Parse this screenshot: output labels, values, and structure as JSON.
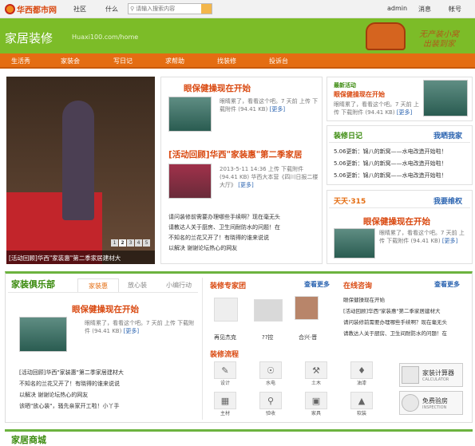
{
  "topbar": {
    "logo": "华西都市网",
    "community": "社区",
    "what": "什么",
    "search_placeholder": "请输入搜索内容",
    "admin": "admin",
    "message": "消息",
    "account": "帐号"
  },
  "header": {
    "title": "家居装修",
    "url": "Huaxi100.com/home",
    "slogan_1": "无产装小窝",
    "slogan_2": "出装到家"
  },
  "nav": [
    "生活秀",
    "家装会",
    "写日记",
    "求帮助",
    "找装修",
    "投诉台"
  ],
  "slideshow": {
    "caption": "[活动回顾]华西\"家装惠\"第二季家居建材大",
    "pages": [
      "1",
      "2",
      "3",
      "4",
      "5"
    ],
    "active": "2"
  },
  "feature1": {
    "title": "眼保健操现在开始",
    "desc": "眼睛累了，看看这个吧。7 天前 上传 下载附件 (94.41 KB)",
    "more": "[更多]"
  },
  "feature2": {
    "title": "[活动回顾]华西\"家装惠\"第二季家居",
    "desc": "2013-5-11 14:36 上传 下载附件 (94.41 KB) 华西大本营《四川日报二楼大厅》",
    "more": "[更多]",
    "list": [
      "请问装修前需要办理哪些手续啊？现在毫无头",
      "请教达人关于厨房、卫生间耐防水的问题！在",
      "不知名的兰花又开了！有晓得的谁来说说",
      "以解决 谢谢论坛热心的网友"
    ]
  },
  "newest": {
    "label": "最新活动",
    "title": "眼保健操现在开始",
    "desc": "眼睛累了，看看这个吧。7 天前 上传 下载附件 (94.41 KB)",
    "more": "[更多]"
  },
  "diary": {
    "title": "装修日记",
    "link": "我晒我家",
    "items": [
      "5.06更新：锦八的新窝——水电改造开始啦！",
      "5.06更新：锦八的新窝——水电改造开始啦！",
      "5.06更新：锦八的新窝——水电改造开始啦！"
    ]
  },
  "rights": {
    "title": "天天·315",
    "link": "我要维权",
    "item_title": "眼保健操现在开始",
    "desc": "眼睛累了，看看这个吧。7 天前 上传 下载附件 (94.41 KB)",
    "more": "[更多]"
  },
  "club": {
    "title": "家装俱乐部",
    "tabs": [
      "家装惠",
      "放心装",
      "小编行动"
    ],
    "item_title": "眼保健操现在开始",
    "desc": "眼睛累了，看看这个吧。7 天前 上传 下载附件 (94.41 KB)",
    "more": "[更多]",
    "list": [
      "[活动回顾]华西\"家装惠\"第二季家居建材大",
      "不知名的兰花又开了！有晓得的谁来说说",
      "以解决 谢谢论坛热心的网友",
      "该晒\"放心装\"，骚先亲家开工啦！小丫手"
    ]
  },
  "experts": {
    "title": "装修专家团",
    "more": "查看更多",
    "names": [
      "再见杰克",
      "??控",
      "合兴·晋"
    ]
  },
  "consult": {
    "title": "在线咨询",
    "more": "查看更多",
    "items": [
      "眼保健操现在开始",
      "[活动回顾]华西\"家装惠\"第二季家居建材大",
      "请问装修前需要办理哪些手续啊？现在毫无头",
      "请教达人关于厨房、卫生间耐防水的问题！在"
    ]
  },
  "process": {
    "title": "装修流程",
    "steps": [
      "设计",
      "水电",
      "土木",
      "油漆",
      "主材",
      "验收",
      "家具",
      "软装"
    ],
    "calc_title": "家装计算器",
    "calc_sub": "CALCULATOR",
    "inspect_title": "免费验房",
    "inspect_sub": "INSPECTION"
  },
  "bottom": {
    "title": "家居商城"
  }
}
